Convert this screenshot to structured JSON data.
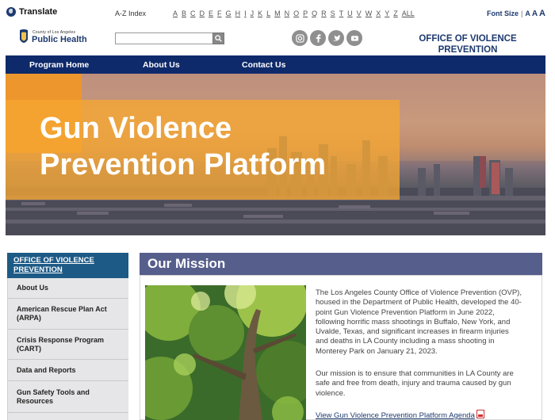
{
  "utility": {
    "translate_label": "Translate",
    "az_label": "A-Z Index",
    "letters": [
      "A",
      "B",
      "C",
      "D",
      "E",
      "F",
      "G",
      "H",
      "I",
      "J",
      "K",
      "L",
      "M",
      "N",
      "O",
      "P",
      "Q",
      "R",
      "S",
      "T",
      "U",
      "V",
      "W",
      "X",
      "Y",
      "Z",
      "ALL"
    ],
    "font_size_label": "Font Size",
    "font_size_options": [
      "A",
      "A",
      "A"
    ]
  },
  "header": {
    "logo_county_text": "County of Los Angeles",
    "logo_name": "Public Health",
    "search_placeholder": "",
    "social_icons": [
      "instagram-icon",
      "facebook-icon",
      "twitter-icon",
      "youtube-icon"
    ],
    "office_title": "OFFICE OF VIOLENCE PREVENTION"
  },
  "nav": {
    "items": [
      "Program Home",
      "About Us",
      "Contact Us"
    ]
  },
  "hero": {
    "title_line1": "Gun Violence",
    "title_line2": "Prevention Platform"
  },
  "sidebar": {
    "heading": "OFFICE OF VIOLENCE PREVENTION",
    "items": [
      "About Us",
      "American Rescue Plan Act (ARPA)",
      "Crisis Response Program (CART)",
      "Data and Reports",
      "Gun Safety Tools and Resources"
    ]
  },
  "mission": {
    "heading": "Our Mission",
    "paragraph1": "The Los Angeles County Office of Violence Prevention (OVP), housed in the Department of Public Health, developed the 40-point Gun Violence Prevention Platform in June 2022, following horrific mass shootings in Buffalo, New York, and Uvalde, Texas, and significant increases in firearm injuries and deaths in LA County including a mass shooting in Monterey Park on January 21, 2023.",
    "paragraph2": "Our mission is to ensure that communities in LA County are safe and free from death, injury and trauma caused by gun violence.",
    "agenda_link": "View Gun Violence Prevention Platform Agenda"
  },
  "colors": {
    "nav_bg": "#0f2a6a",
    "brand_blue": "#1d3a6e",
    "sidebar_head": "#1d5a86",
    "mission_head": "#565e8c",
    "hero_orange": "#f6a632"
  }
}
